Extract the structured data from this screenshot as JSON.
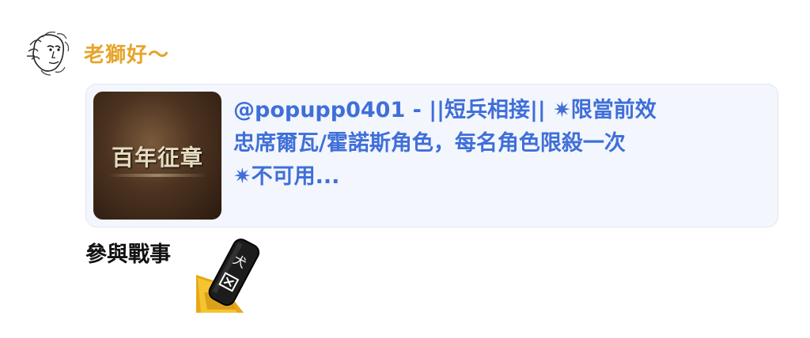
{
  "message": {
    "username": "老獅好～",
    "link_preview": {
      "thumbnail_title": "百年征章",
      "text_line1": "@popupp0401 - ||短兵相接|| ✷限當前效",
      "text_line2": "忠席爾瓦/霍諾斯角色，每名角色限殺一次",
      "text_line3": "✷不可用..."
    },
    "body_text": "參與戰事",
    "sticker_icon": "dagger-sticker-icon"
  },
  "colors": {
    "username": "#e5a52a",
    "link_text": "#3f6fd8",
    "card_background": "#f3f6fd"
  }
}
